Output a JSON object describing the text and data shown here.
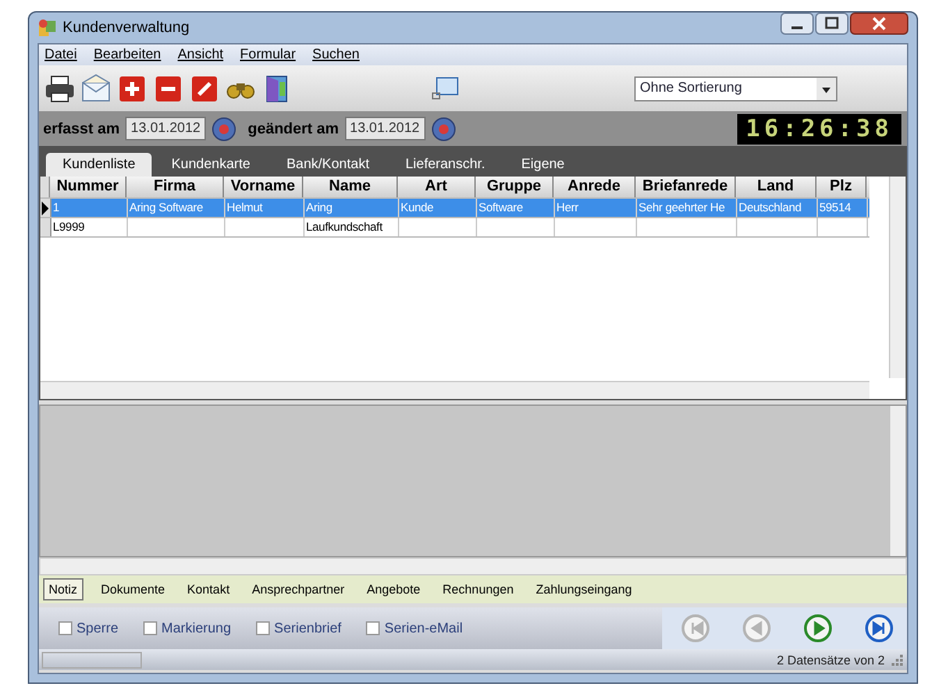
{
  "window": {
    "title": "Kundenverwaltung"
  },
  "menu": [
    "Datei",
    "Bearbeiten",
    "Ansicht",
    "Formular",
    "Suchen"
  ],
  "toolbar": {
    "sort": {
      "value": "Ohne Sortierung"
    }
  },
  "dates": [
    {
      "label": "erfasst am",
      "value": "13.01.2012"
    },
    {
      "label": "geändert am",
      "value": "13.01.2012"
    }
  ],
  "clock": "16:26:38",
  "tabs": [
    {
      "label": "Kundenliste",
      "selected": true
    },
    {
      "label": "Kundenkarte",
      "selected": false
    },
    {
      "label": "Bank/Kontakt",
      "selected": false
    },
    {
      "label": "Lieferanschr.",
      "selected": false
    },
    {
      "label": "Eigene",
      "selected": false
    }
  ],
  "table": {
    "columns": [
      "Nummer",
      "Firma",
      "Vorname",
      "Name",
      "Art",
      "Gruppe",
      "Anrede",
      "Briefanrede",
      "Land",
      "Plz"
    ],
    "rows": [
      {
        "selected": true,
        "cells": [
          "1",
          "Aring Software",
          "Helmut",
          "Aring",
          "Kunde",
          "Software",
          "Herr",
          "Sehr geehrter He",
          "Deutschland",
          "59514"
        ]
      },
      {
        "selected": false,
        "cells": [
          "L9999",
          "",
          "",
          "Laufkundschaft",
          "",
          "",
          "",
          "",
          "",
          ""
        ]
      }
    ]
  },
  "detail_tabs": [
    {
      "label": "Notiz",
      "selected": true
    },
    {
      "label": "Dokumente",
      "selected": false
    },
    {
      "label": "Kontakt",
      "selected": false
    },
    {
      "label": "Ansprechpartner",
      "selected": false
    },
    {
      "label": "Angebote",
      "selected": false
    },
    {
      "label": "Rechnungen",
      "selected": false
    },
    {
      "label": "Zahlungseingang",
      "selected": false
    }
  ],
  "options": [
    {
      "label": "Sperre",
      "checked": false
    },
    {
      "label": "Markierung",
      "checked": false
    },
    {
      "label": "Serienbrief",
      "checked": false
    },
    {
      "label": "Serien-eMail",
      "checked": false
    }
  ],
  "navigation": [
    {
      "kind": "first",
      "disabled": true
    },
    {
      "kind": "previous",
      "disabled": true
    },
    {
      "kind": "next",
      "disabled": false
    },
    {
      "kind": "last",
      "disabled": false
    }
  ],
  "status_bar": {
    "text": "2 Datensätze von 2"
  }
}
